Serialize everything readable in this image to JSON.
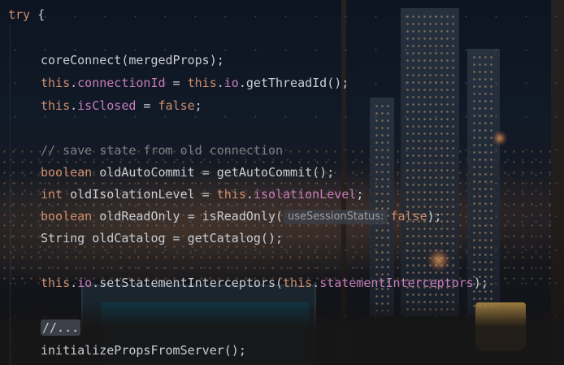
{
  "editor": {
    "lines": [
      [
        {
          "t": "try",
          "c": "kw"
        },
        {
          "t": " {",
          "c": "plain"
        }
      ],
      [],
      [
        {
          "t": "coreConnect(mergedProps);",
          "c": "plain"
        }
      ],
      [
        {
          "t": "this",
          "c": "kw"
        },
        {
          "t": ".",
          "c": "plain"
        },
        {
          "t": "connectionId",
          "c": "field"
        },
        {
          "t": " = ",
          "c": "plain"
        },
        {
          "t": "this",
          "c": "kw"
        },
        {
          "t": ".",
          "c": "plain"
        },
        {
          "t": "io",
          "c": "field"
        },
        {
          "t": ".getThreadId();",
          "c": "plain"
        }
      ],
      [
        {
          "t": "this",
          "c": "kw"
        },
        {
          "t": ".",
          "c": "plain"
        },
        {
          "t": "isClosed",
          "c": "field"
        },
        {
          "t": " = ",
          "c": "plain"
        },
        {
          "t": "false",
          "c": "kw"
        },
        {
          "t": ";",
          "c": "plain"
        }
      ],
      [],
      [
        {
          "t": "// save state from old connection",
          "c": "comment"
        }
      ],
      [
        {
          "t": "boolean",
          "c": "kw"
        },
        {
          "t": " oldAutoCommit = getAutoCommit();",
          "c": "plain"
        }
      ],
      [
        {
          "t": "int",
          "c": "kw"
        },
        {
          "t": " oldIsolationLevel = ",
          "c": "plain"
        },
        {
          "t": "this",
          "c": "kw"
        },
        {
          "t": ".",
          "c": "plain"
        },
        {
          "t": "isolationLevel",
          "c": "field"
        },
        {
          "t": ";",
          "c": "plain"
        }
      ],
      [
        {
          "t": "boolean",
          "c": "kw"
        },
        {
          "t": " oldReadOnly = isReadOnly(",
          "c": "plain"
        },
        {
          "t": "useSessionStatus:",
          "c": "hint"
        },
        {
          "t": "false",
          "c": "kw"
        },
        {
          "t": ");",
          "c": "plain"
        }
      ],
      [
        {
          "t": "String oldCatalog = getCatalog();",
          "c": "plain"
        }
      ],
      [],
      [
        {
          "t": "this",
          "c": "kw"
        },
        {
          "t": ".",
          "c": "plain"
        },
        {
          "t": "io",
          "c": "field"
        },
        {
          "t": ".setStatementInterceptors(",
          "c": "plain"
        },
        {
          "t": "this",
          "c": "kw"
        },
        {
          "t": ".",
          "c": "plain"
        },
        {
          "t": "statementInterceptors",
          "c": "field"
        },
        {
          "t": ");",
          "c": "plain"
        }
      ],
      [],
      [
        {
          "t": "//...",
          "c": "fold"
        }
      ],
      [
        {
          "t": "initializePropsFromServer();",
          "c": "plain"
        }
      ]
    ]
  },
  "colors": {
    "keyword": "#cf8e6d",
    "field": "#c77dbb",
    "text": "#c9cdd3",
    "comment": "#7a7e85",
    "hint_bg": "#3c4048"
  }
}
